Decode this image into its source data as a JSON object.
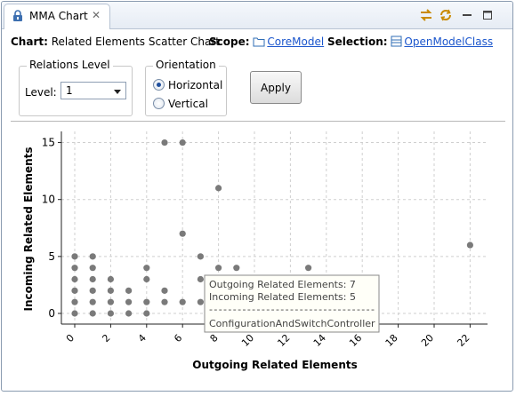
{
  "tab": {
    "title": "MMA Chart"
  },
  "info": {
    "chart_label": "Chart:",
    "chart_value": "Related Elements Scatter Chart",
    "scope_label": "Scope:",
    "scope_link": "CoreModel",
    "selection_label": "Selection:",
    "selection_link": "OpenModelClass"
  },
  "relations": {
    "legend": "Relations Level",
    "level_label": "Level:",
    "level_value": "1"
  },
  "orientation": {
    "legend": "Orientation",
    "options": [
      "Horizontal",
      "Vertical"
    ],
    "selected": "Horizontal"
  },
  "apply_label": "Apply",
  "colors": {
    "point": "#7a7a7a",
    "link": "#1a55cc",
    "grid": "#cfcfcf"
  },
  "tooltip": {
    "line1": "Outgoing Related Elements: 7",
    "line2": "Incoming Related Elements: 5",
    "separator": "-----------------------------------",
    "line3": "ConfigurationAndSwitchController"
  },
  "chart_data": {
    "type": "scatter",
    "xlabel": "Outgoing Related Elements",
    "ylabel": "Incoming Related Elements",
    "xlim": [
      -0.5,
      22.5
    ],
    "ylim": [
      -1,
      16
    ],
    "xticks": [
      0,
      2,
      4,
      6,
      8,
      10,
      12,
      14,
      16,
      18,
      20,
      22
    ],
    "yticks": [
      0,
      5,
      10,
      15
    ],
    "grid": true,
    "points": [
      [
        0,
        0
      ],
      [
        0,
        1
      ],
      [
        0,
        2
      ],
      [
        0,
        3
      ],
      [
        0,
        4
      ],
      [
        0,
        5
      ],
      [
        1,
        0
      ],
      [
        1,
        1
      ],
      [
        1,
        2
      ],
      [
        1,
        3
      ],
      [
        1,
        4
      ],
      [
        1,
        5
      ],
      [
        2,
        0
      ],
      [
        2,
        1
      ],
      [
        2,
        2
      ],
      [
        2,
        3
      ],
      [
        3,
        0
      ],
      [
        3,
        1
      ],
      [
        3,
        2
      ],
      [
        4,
        0
      ],
      [
        4,
        1
      ],
      [
        4,
        3
      ],
      [
        4,
        4
      ],
      [
        5,
        1
      ],
      [
        5,
        2
      ],
      [
        5,
        15
      ],
      [
        6,
        1
      ],
      [
        6,
        7
      ],
      [
        6,
        15
      ],
      [
        7,
        1
      ],
      [
        7,
        3
      ],
      [
        7,
        5
      ],
      [
        8,
        4
      ],
      [
        8,
        11
      ],
      [
        9,
        4
      ],
      [
        13,
        4
      ],
      [
        22,
        6
      ]
    ]
  }
}
